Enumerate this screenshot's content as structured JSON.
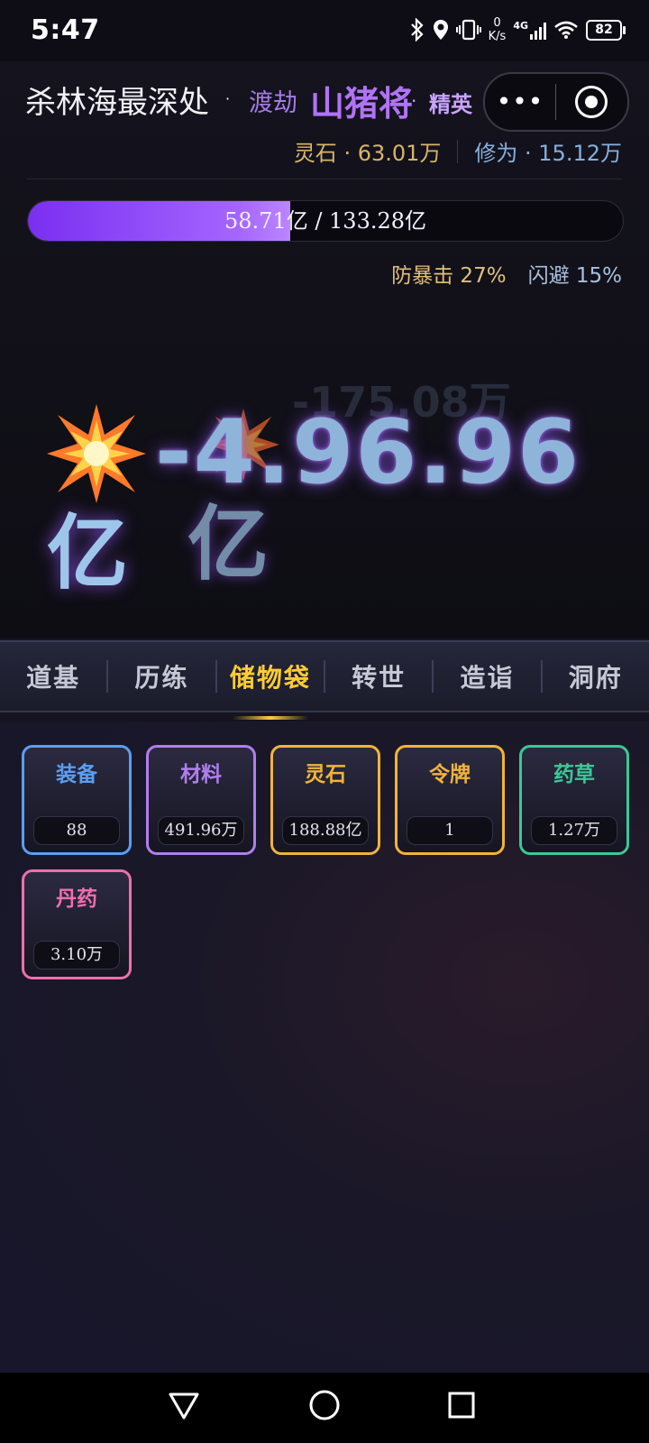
{
  "status_bar": {
    "time": "5:47",
    "net_speed_value": "0",
    "net_speed_unit": "K/s",
    "network": "4G",
    "battery": "82"
  },
  "header": {
    "location": "杀林海最深处",
    "realm": "渡劫",
    "enemy_name": "山猪将",
    "rank": "精英",
    "separator": "·",
    "menu_dots": "•••"
  },
  "resources": {
    "stone_label": "灵石 · 63.01万",
    "cultivation_label": "修为 · 15.12万"
  },
  "hp": {
    "text": "58.71亿 / 133.28亿",
    "fraction": 0.4405
  },
  "defense": {
    "anti_crit": "防暴击 27%",
    "dodge": "闪避 15%"
  },
  "damage": {
    "faint_text": "-175.08万",
    "main_text": "-4.96.96",
    "unit_1": "亿",
    "unit_2": "亿"
  },
  "tabs": [
    {
      "label": "道基"
    },
    {
      "label": "历练"
    },
    {
      "label": "储物袋"
    },
    {
      "label": "转世"
    },
    {
      "label": "造诣"
    },
    {
      "label": "洞府"
    }
  ],
  "inventory": [
    {
      "label": "装备",
      "value": "88",
      "color": "#5b9ef0"
    },
    {
      "label": "材料",
      "value": "491.96万",
      "color": "#b07ef0"
    },
    {
      "label": "灵石",
      "value": "188.88亿",
      "color": "#f0b43a"
    },
    {
      "label": "令牌",
      "value": "1",
      "color": "#f0b43a"
    },
    {
      "label": "药草",
      "value": "1.27万",
      "color": "#3ac996"
    },
    {
      "label": "丹药",
      "value": "3.10万",
      "color": "#ef6fae"
    }
  ]
}
